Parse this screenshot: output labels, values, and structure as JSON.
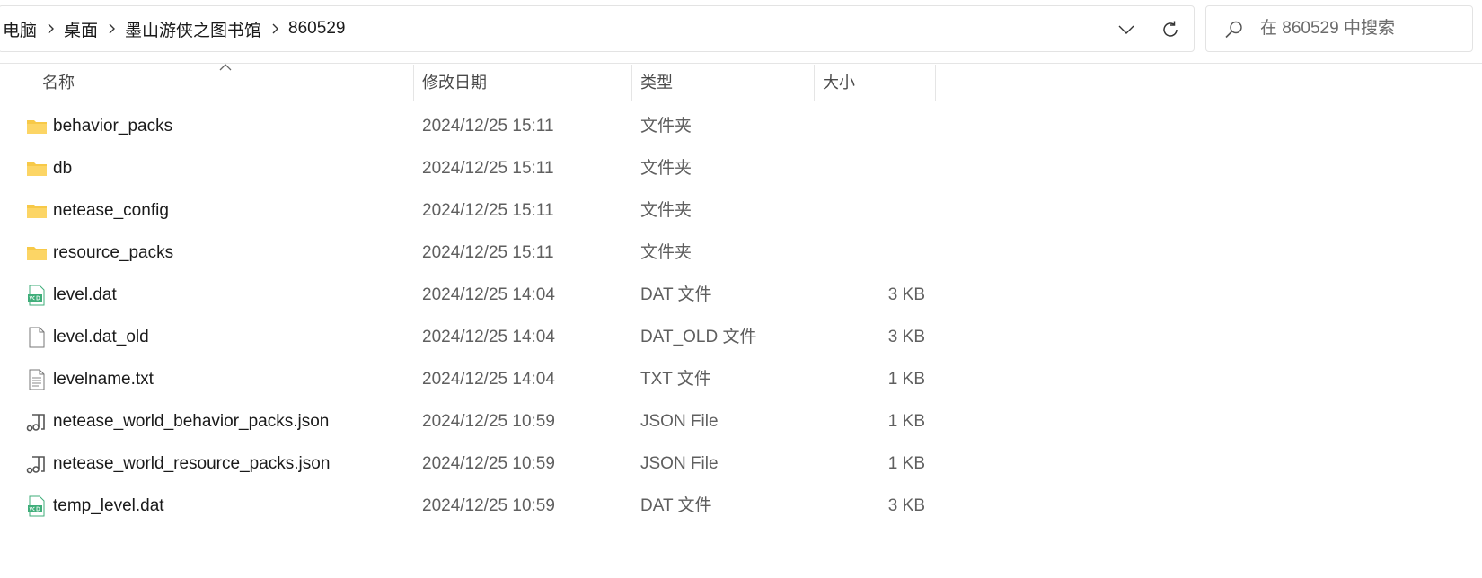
{
  "address": {
    "crumbs": [
      "电脑",
      "桌面",
      "墨山游侠之图书馆",
      "860529"
    ]
  },
  "search": {
    "placeholder": "在 860529 中搜索"
  },
  "columns": {
    "name": "名称",
    "modified": "修改日期",
    "type": "类型",
    "size": "大小"
  },
  "files": [
    {
      "name": "behavior_packs",
      "modified": "2024/12/25 15:11",
      "type": "文件夹",
      "size": "",
      "icon": "folder-icon"
    },
    {
      "name": "db",
      "modified": "2024/12/25 15:11",
      "type": "文件夹",
      "size": "",
      "icon": "folder-icon"
    },
    {
      "name": "netease_config",
      "modified": "2024/12/25 15:11",
      "type": "文件夹",
      "size": "",
      "icon": "folder-icon"
    },
    {
      "name": "resource_packs",
      "modified": "2024/12/25 15:11",
      "type": "文件夹",
      "size": "",
      "icon": "folder-icon"
    },
    {
      "name": "level.dat",
      "modified": "2024/12/25 14:04",
      "type": "DAT 文件",
      "size": "3 KB",
      "icon": "vcd-file-icon"
    },
    {
      "name": "level.dat_old",
      "modified": "2024/12/25 14:04",
      "type": "DAT_OLD 文件",
      "size": "3 KB",
      "icon": "blank-file-icon"
    },
    {
      "name": "levelname.txt",
      "modified": "2024/12/25 14:04",
      "type": "TXT 文件",
      "size": "1 KB",
      "icon": "text-file-icon"
    },
    {
      "name": "netease_world_behavior_packs.json",
      "modified": "2024/12/25 10:59",
      "type": "JSON File",
      "size": "1 KB",
      "icon": "json-file-icon"
    },
    {
      "name": "netease_world_resource_packs.json",
      "modified": "2024/12/25 10:59",
      "type": "JSON File",
      "size": "1 KB",
      "icon": "json-file-icon"
    },
    {
      "name": "temp_level.dat",
      "modified": "2024/12/25 10:59",
      "type": "DAT 文件",
      "size": "3 KB",
      "icon": "vcd-file-icon"
    }
  ],
  "colors": {
    "folder": "#f7c948",
    "vcd": "#3fae7a",
    "text": "#1a1a1a",
    "muted": "#5f5f5f"
  }
}
